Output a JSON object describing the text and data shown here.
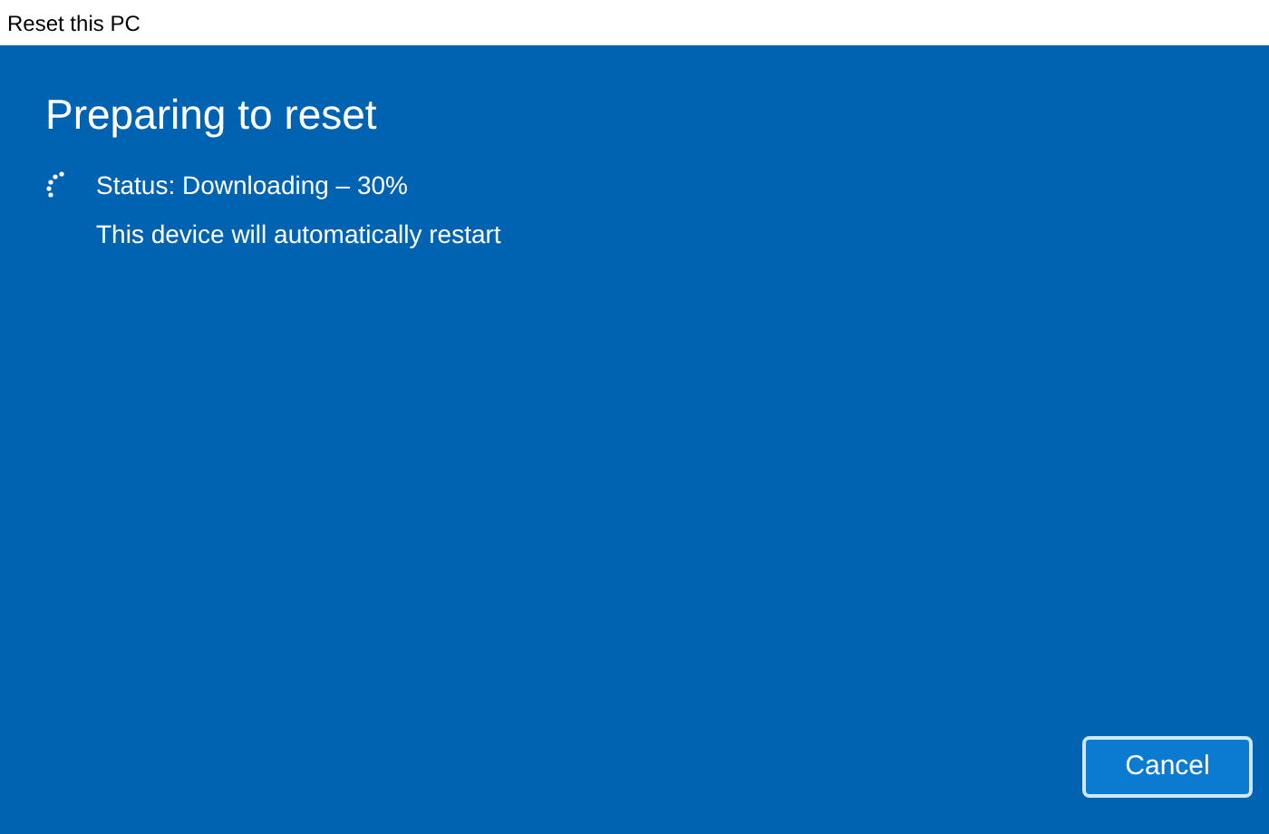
{
  "window": {
    "title": "Reset this PC"
  },
  "heading": "Preparing to reset",
  "status": "Status: Downloading – 30%",
  "note": "This device will automatically restart",
  "buttons": [
    "Cancel"
  ]
}
